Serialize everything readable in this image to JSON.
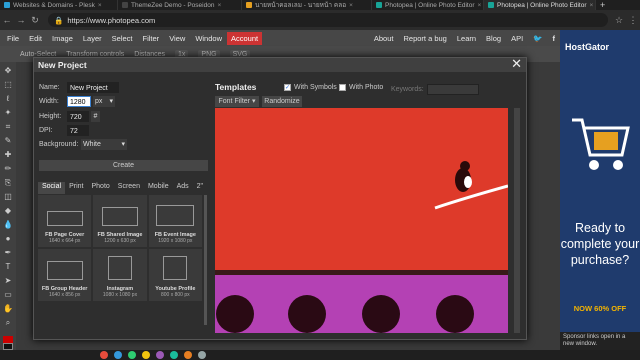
{
  "browser": {
    "tabs": [
      {
        "label": "Websites & Domains - Plesk"
      },
      {
        "label": "ThemeZee Demo - Poseidon"
      },
      {
        "label": "นายหน้าคอลเลม - นายหน้า คลอ"
      },
      {
        "label": "Photopea | Online Photo Editor"
      },
      {
        "label": "Photopea | Online Photo Editor"
      }
    ],
    "url": "https://www.photopea.com",
    "new_tab": "+"
  },
  "menu": {
    "items": [
      "File",
      "Edit",
      "Image",
      "Layer",
      "Select",
      "Filter",
      "View",
      "Window"
    ],
    "account": "Account",
    "right": [
      "About",
      "Report a bug",
      "Learn",
      "Blog",
      "API"
    ]
  },
  "toolbar": {
    "auto_select": "Auto-Select",
    "transform": "Transform controls",
    "distances": "Distances",
    "zoom": "1x",
    "png": "PNG",
    "svg": "SVG"
  },
  "dialog": {
    "title": "New Project",
    "name_label": "Name:",
    "name_value": "New Project",
    "width_label": "Width:",
    "width_value": "1280",
    "width_unit": "px",
    "height_label": "Height:",
    "height_value": "720",
    "height_unit": "#",
    "dpi_label": "DPI:",
    "dpi_value": "72",
    "bg_label": "Background:",
    "bg_value": "White",
    "create": "Create",
    "tabs": [
      "Social",
      "Print",
      "Photo",
      "Screen",
      "Mobile",
      "Ads",
      "2\""
    ],
    "presets": [
      {
        "name": "FB Page Cover",
        "size": "1640 x 664 px"
      },
      {
        "name": "FB Shared Image",
        "size": "1200 x 630 px"
      },
      {
        "name": "FB Event Image",
        "size": "1920 x 1080 px"
      },
      {
        "name": "FB Group Header",
        "size": "1640 x 856 px"
      },
      {
        "name": "Instagram",
        "size": "1080 x 1080 px"
      },
      {
        "name": "Youtube Profile",
        "size": "800 x 800 px"
      }
    ],
    "templates_title": "Templates",
    "with_symbols": "With Symbols",
    "with_photo": "With Photo",
    "keywords_label": "Keywords:",
    "font_filter": "Font Filter",
    "randomize": "Randomize"
  },
  "ad": {
    "brand": "HostGator",
    "headline": "Ready to complete your purchase?",
    "offer": "NOW 60% OFF",
    "sponsor": "Sponsor links open in a new window."
  },
  "colors": {
    "account": "#cc3333",
    "template_top": "#de3a2a",
    "template_bottom": "#b441b4",
    "ad_bg": "#1f3b6d",
    "offer": "#f4b400"
  }
}
